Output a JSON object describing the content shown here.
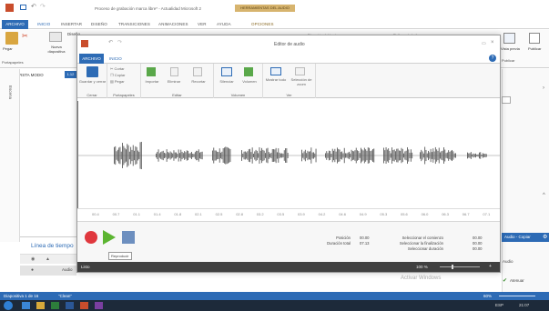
{
  "powerpoint": {
    "title": "Proceso de grabación marca libre* - Actualidad Microsoft 2",
    "context_tab": "HERRAMIENTAS DEL AUDIO",
    "tabs": [
      "ARCHIVO",
      "INICIO",
      "INSERTAR",
      "DISEÑO",
      "TRANSICIONES",
      "ANIMACIONES",
      "VER",
      "AYUDA",
      "OPCIONES"
    ],
    "ribbon": {
      "pegar": "Pegar",
      "nueva": "Nueva diapositiva",
      "diseno": "Diseño",
      "portapapeles": "Portapapeles",
      "direccion": "Dirección del texto",
      "relleno": "Relleno de la forma",
      "vista_previa": "Vista previa",
      "publicar": "Publicar",
      "publicar2": "Publicar",
      "vista_modo": "VISTA MODO",
      "timestamp_small": "1.12"
    },
    "side_label": "Escena",
    "linea_tiempo": "Línea de tiempo",
    "audio_row": "Audio",
    "right_panel": {
      "copiar": "Audio - Copiar",
      "atenuar": "Atenuar",
      "pie": "Audio"
    },
    "status": {
      "slide": "Diapositiva 1 de 16",
      "lang": "\"Clean\"",
      "zoom": "60%",
      "activar": "Activar Windows"
    },
    "taskbar": {
      "lang": "ESP",
      "time": "21:07"
    }
  },
  "editor": {
    "title": "Editor de audio",
    "tabs": [
      "ARCHIVO",
      "INICIO"
    ],
    "groups": {
      "cerrar": {
        "btn": "Guardar y cerrar",
        "label": "Cerrar"
      },
      "portapapeles": {
        "items": [
          "Cortar",
          "Copiar",
          "Pegar"
        ],
        "label": "Portapapeles"
      },
      "editar": {
        "items": [
          "Importar",
          "Eliminar",
          "Recortar"
        ],
        "label": "Editar"
      },
      "volumen": {
        "items": [
          "Silenciar",
          "Volumen"
        ],
        "label": "Volumen"
      },
      "ver": {
        "items": [
          "Mostrar todo",
          "Selección de zoom"
        ],
        "label": "Ver"
      }
    },
    "timeline_ticks": [
      "00.4",
      "00.7",
      "01.1",
      "01.4",
      "01.8",
      "02.1",
      "02.5",
      "02.8",
      "03.2",
      "03.5",
      "03.9",
      "04.2",
      "04.6",
      "04.9",
      "05.3",
      "05.6",
      "06.0",
      "06.3",
      "06.7",
      "07.1"
    ],
    "info": {
      "posicion_label": "Posición",
      "posicion_value": "00.00",
      "duracion_label": "Duración total",
      "duracion_value": "07.13",
      "sel_comienzo_label": "Seleccionar el comienzo",
      "sel_comienzo_value": "00.00",
      "sel_final_label": "Seleccionar la finalización",
      "sel_final_value": "00.00",
      "sel_duracion_label": "Seleccionar duración",
      "sel_duracion_value": "00.00"
    },
    "tooltip": "Reproducir",
    "status_left": "Listo",
    "zoom": "100 %"
  },
  "colors": {
    "accent_blue": "#2d6bb5",
    "record": "#e0383e",
    "play": "#5cb531",
    "stop": "#6d8fbf",
    "wave": "#555555"
  }
}
